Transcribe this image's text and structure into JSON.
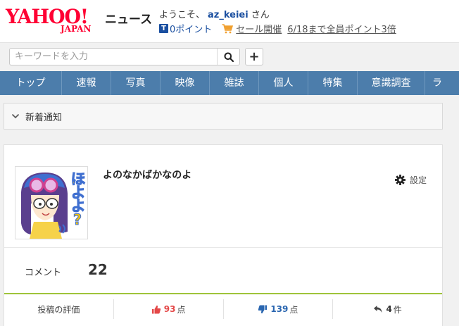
{
  "header": {
    "logo_main": "YAHOO!",
    "logo_sub": "JAPAN",
    "service_name": "ニュース",
    "welcome_prefix": "ようこそ、",
    "username": "az_keiei",
    "welcome_suffix": "さん",
    "t_icon": "T",
    "points": "0ポイント",
    "sale_link": "セール開催",
    "sale_detail": "6/18まで全員ポイント3倍"
  },
  "search": {
    "placeholder": "キーワードを入力",
    "value": "",
    "search_icon": "search-icon",
    "plus_label": "+"
  },
  "nav": {
    "items": [
      {
        "label": "トップ"
      },
      {
        "label": "速報"
      },
      {
        "label": "写真"
      },
      {
        "label": "映像"
      },
      {
        "label": "雑誌"
      },
      {
        "label": "個人"
      },
      {
        "label": "特集"
      },
      {
        "label": "意識調査"
      },
      {
        "label": "ラ"
      }
    ]
  },
  "notice": {
    "label": "新着通知",
    "icon": "chevron-down-icon"
  },
  "profile": {
    "name": "よのなかばかなのよ",
    "settings_label": "設定",
    "avatar_text": "ほよよ?",
    "comment_label": "コメント",
    "comment_count": "22"
  },
  "stats": {
    "rating_label": "投稿の評価",
    "good_count": "93",
    "good_unit": "点",
    "bad_count": "139",
    "bad_unit": "点",
    "reply_count": "4",
    "reply_unit": "件"
  },
  "colors": {
    "brand_red": "#ff0033",
    "nav_blue": "#4c7dab",
    "link_blue": "#1a4fa0",
    "accent_green": "#9fc43a",
    "good_red": "#e44848",
    "bad_blue": "#2a66b0"
  }
}
